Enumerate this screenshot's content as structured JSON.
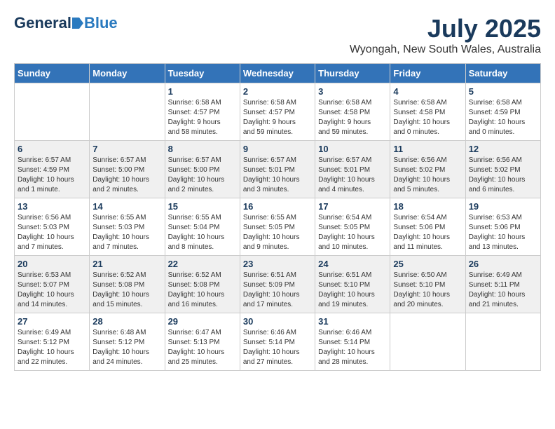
{
  "header": {
    "logo": {
      "general": "General",
      "blue": "Blue"
    },
    "title": "July 2025",
    "location": "Wyongah, New South Wales, Australia"
  },
  "calendar": {
    "days_of_week": [
      "Sunday",
      "Monday",
      "Tuesday",
      "Wednesday",
      "Thursday",
      "Friday",
      "Saturday"
    ],
    "weeks": [
      [
        {
          "day": "",
          "info": ""
        },
        {
          "day": "",
          "info": ""
        },
        {
          "day": "1",
          "info": "Sunrise: 6:58 AM\nSunset: 4:57 PM\nDaylight: 9 hours\nand 58 minutes."
        },
        {
          "day": "2",
          "info": "Sunrise: 6:58 AM\nSunset: 4:57 PM\nDaylight: 9 hours\nand 59 minutes."
        },
        {
          "day": "3",
          "info": "Sunrise: 6:58 AM\nSunset: 4:58 PM\nDaylight: 9 hours\nand 59 minutes."
        },
        {
          "day": "4",
          "info": "Sunrise: 6:58 AM\nSunset: 4:58 PM\nDaylight: 10 hours\nand 0 minutes."
        },
        {
          "day": "5",
          "info": "Sunrise: 6:58 AM\nSunset: 4:59 PM\nDaylight: 10 hours\nand 0 minutes."
        }
      ],
      [
        {
          "day": "6",
          "info": "Sunrise: 6:57 AM\nSunset: 4:59 PM\nDaylight: 10 hours\nand 1 minute."
        },
        {
          "day": "7",
          "info": "Sunrise: 6:57 AM\nSunset: 5:00 PM\nDaylight: 10 hours\nand 2 minutes."
        },
        {
          "day": "8",
          "info": "Sunrise: 6:57 AM\nSunset: 5:00 PM\nDaylight: 10 hours\nand 2 minutes."
        },
        {
          "day": "9",
          "info": "Sunrise: 6:57 AM\nSunset: 5:01 PM\nDaylight: 10 hours\nand 3 minutes."
        },
        {
          "day": "10",
          "info": "Sunrise: 6:57 AM\nSunset: 5:01 PM\nDaylight: 10 hours\nand 4 minutes."
        },
        {
          "day": "11",
          "info": "Sunrise: 6:56 AM\nSunset: 5:02 PM\nDaylight: 10 hours\nand 5 minutes."
        },
        {
          "day": "12",
          "info": "Sunrise: 6:56 AM\nSunset: 5:02 PM\nDaylight: 10 hours\nand 6 minutes."
        }
      ],
      [
        {
          "day": "13",
          "info": "Sunrise: 6:56 AM\nSunset: 5:03 PM\nDaylight: 10 hours\nand 7 minutes."
        },
        {
          "day": "14",
          "info": "Sunrise: 6:55 AM\nSunset: 5:03 PM\nDaylight: 10 hours\nand 7 minutes."
        },
        {
          "day": "15",
          "info": "Sunrise: 6:55 AM\nSunset: 5:04 PM\nDaylight: 10 hours\nand 8 minutes."
        },
        {
          "day": "16",
          "info": "Sunrise: 6:55 AM\nSunset: 5:05 PM\nDaylight: 10 hours\nand 9 minutes."
        },
        {
          "day": "17",
          "info": "Sunrise: 6:54 AM\nSunset: 5:05 PM\nDaylight: 10 hours\nand 10 minutes."
        },
        {
          "day": "18",
          "info": "Sunrise: 6:54 AM\nSunset: 5:06 PM\nDaylight: 10 hours\nand 11 minutes."
        },
        {
          "day": "19",
          "info": "Sunrise: 6:53 AM\nSunset: 5:06 PM\nDaylight: 10 hours\nand 13 minutes."
        }
      ],
      [
        {
          "day": "20",
          "info": "Sunrise: 6:53 AM\nSunset: 5:07 PM\nDaylight: 10 hours\nand 14 minutes."
        },
        {
          "day": "21",
          "info": "Sunrise: 6:52 AM\nSunset: 5:08 PM\nDaylight: 10 hours\nand 15 minutes."
        },
        {
          "day": "22",
          "info": "Sunrise: 6:52 AM\nSunset: 5:08 PM\nDaylight: 10 hours\nand 16 minutes."
        },
        {
          "day": "23",
          "info": "Sunrise: 6:51 AM\nSunset: 5:09 PM\nDaylight: 10 hours\nand 17 minutes."
        },
        {
          "day": "24",
          "info": "Sunrise: 6:51 AM\nSunset: 5:10 PM\nDaylight: 10 hours\nand 19 minutes."
        },
        {
          "day": "25",
          "info": "Sunrise: 6:50 AM\nSunset: 5:10 PM\nDaylight: 10 hours\nand 20 minutes."
        },
        {
          "day": "26",
          "info": "Sunrise: 6:49 AM\nSunset: 5:11 PM\nDaylight: 10 hours\nand 21 minutes."
        }
      ],
      [
        {
          "day": "27",
          "info": "Sunrise: 6:49 AM\nSunset: 5:12 PM\nDaylight: 10 hours\nand 22 minutes."
        },
        {
          "day": "28",
          "info": "Sunrise: 6:48 AM\nSunset: 5:12 PM\nDaylight: 10 hours\nand 24 minutes."
        },
        {
          "day": "29",
          "info": "Sunrise: 6:47 AM\nSunset: 5:13 PM\nDaylight: 10 hours\nand 25 minutes."
        },
        {
          "day": "30",
          "info": "Sunrise: 6:46 AM\nSunset: 5:14 PM\nDaylight: 10 hours\nand 27 minutes."
        },
        {
          "day": "31",
          "info": "Sunrise: 6:46 AM\nSunset: 5:14 PM\nDaylight: 10 hours\nand 28 minutes."
        },
        {
          "day": "",
          "info": ""
        },
        {
          "day": "",
          "info": ""
        }
      ]
    ]
  }
}
